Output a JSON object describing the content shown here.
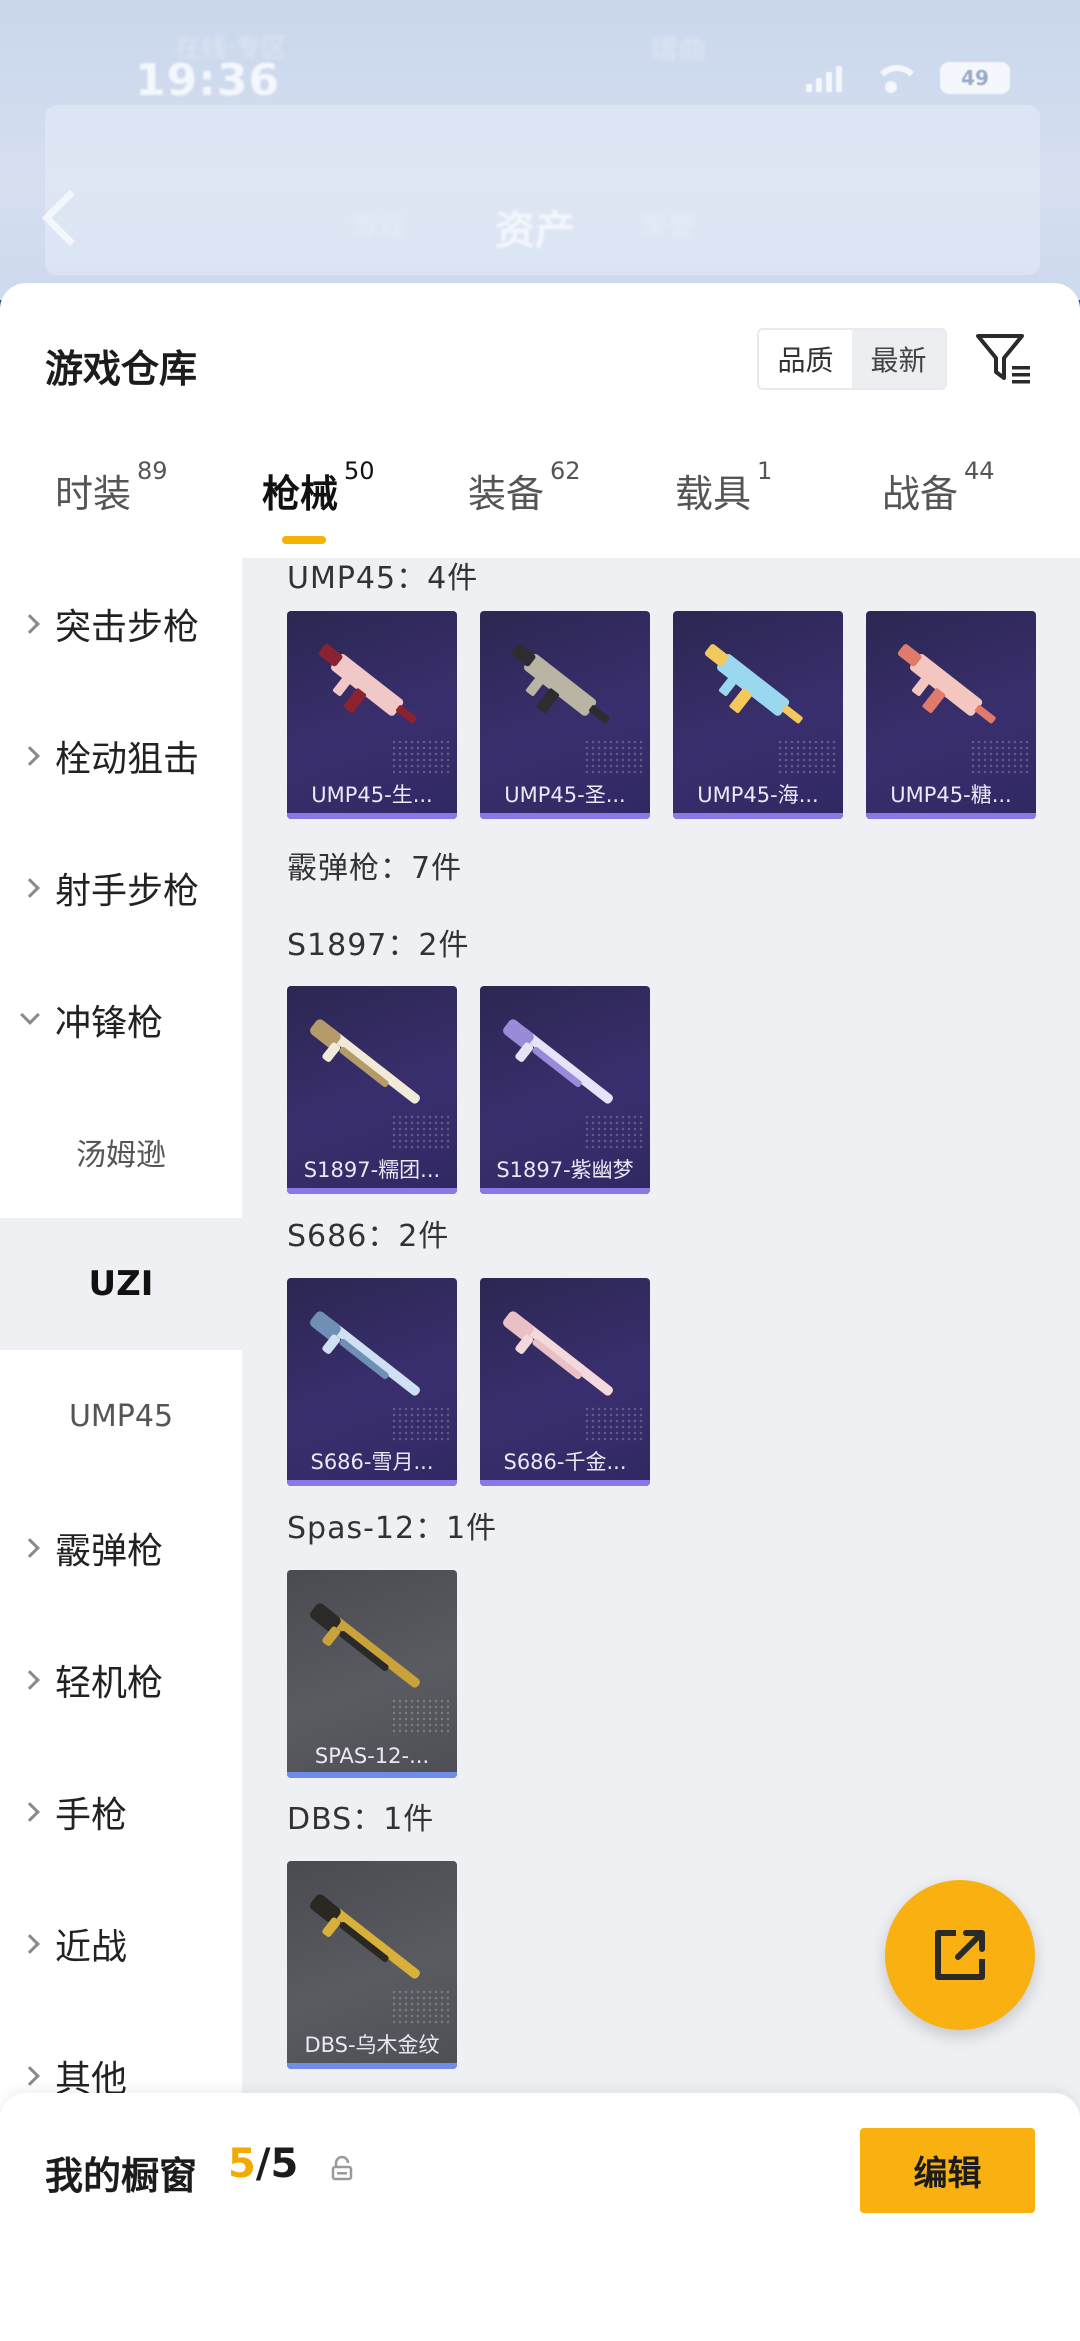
{
  "status_bar": {
    "time": "19:36",
    "battery": "49",
    "blurred_carrier": "在线·专区",
    "blurred_name": "熠曲"
  },
  "header": {
    "title": "资产",
    "ghost_left": "游戏",
    "ghost_right": "荣誉"
  },
  "warehouse": {
    "title": "游戏仓库",
    "sort_options": [
      "品质",
      "最新"
    ],
    "tabs": [
      {
        "label": "时装",
        "count": "89"
      },
      {
        "label": "枪械",
        "count": "50"
      },
      {
        "label": "装备",
        "count": "62"
      },
      {
        "label": "载具",
        "count": "1"
      },
      {
        "label": "战备",
        "count": "44"
      }
    ],
    "active_tab": "枪械"
  },
  "sidebar": {
    "items": [
      {
        "label": "突击步枪",
        "type": "category"
      },
      {
        "label": "栓动狙击",
        "type": "category"
      },
      {
        "label": "射手步枪",
        "type": "category"
      },
      {
        "label": "冲锋枪",
        "type": "category-open"
      },
      {
        "label": "汤姆逊",
        "type": "sub"
      },
      {
        "label": "UZI",
        "type": "sub-selected"
      },
      {
        "label": "UMP45",
        "type": "sub"
      },
      {
        "label": "霰弹枪",
        "type": "category"
      },
      {
        "label": "轻机枪",
        "type": "category"
      },
      {
        "label": "手枪",
        "type": "category"
      },
      {
        "label": "近战",
        "type": "category"
      },
      {
        "label": "其他",
        "type": "category"
      }
    ]
  },
  "content": {
    "groups": [
      {
        "label": "UMP45：4件"
      },
      {
        "label": "霰弹枪：7件"
      },
      {
        "label": "S1897：2件"
      },
      {
        "label": "S686：2件"
      },
      {
        "label": "Spas-12：1件"
      },
      {
        "label": "DBS：1件"
      }
    ],
    "cards": [
      {
        "name": "UMP45-生...",
        "colors": [
          "#f0c8c8",
          "#8b2230"
        ]
      },
      {
        "name": "UMP45-圣...",
        "colors": [
          "#b9b4a4",
          "#2e2c30"
        ]
      },
      {
        "name": "UMP45-海...",
        "colors": [
          "#9ad8f0",
          "#f3c95d"
        ]
      },
      {
        "name": "UMP45-糖...",
        "colors": [
          "#f4c6c0",
          "#e07a6a"
        ]
      },
      {
        "name": "S1897-糯团...",
        "colors": [
          "#f2ead8",
          "#b59a6a"
        ]
      },
      {
        "name": "S1897-紫幽梦",
        "colors": [
          "#e6e2f7",
          "#9a8ad8"
        ]
      },
      {
        "name": "S686-雪月...",
        "colors": [
          "#cfe0f2",
          "#6f8fb5"
        ]
      },
      {
        "name": "S686-千金...",
        "colors": [
          "#f3d8dc",
          "#e8c0c6"
        ]
      },
      {
        "name": "SPAS-12-...",
        "colors": [
          "#c9a23a",
          "#2a2a28"
        ]
      },
      {
        "name": "DBS-乌木金纹",
        "colors": [
          "#d8b03a",
          "#2a2820"
        ]
      }
    ]
  },
  "bottom_bar": {
    "title": "我的橱窗",
    "count_current": "5",
    "count_total": "/5",
    "edit_label": "编辑"
  },
  "colors": {
    "accent": "#f8b110",
    "card_purple": "#3a2f6e",
    "card_grey": "#55565c",
    "rarity_purple": "#8b78e6",
    "rarity_blue": "#6f8de8"
  }
}
